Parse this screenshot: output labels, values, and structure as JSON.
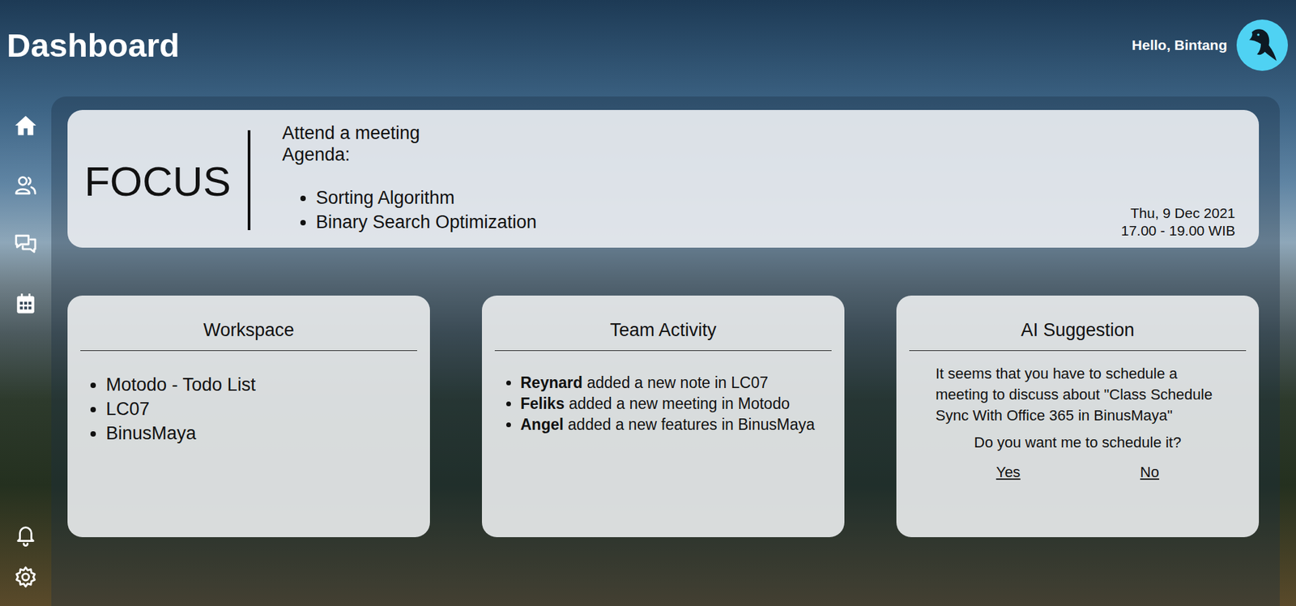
{
  "header": {
    "title": "Dashboard",
    "greeting": "Hello, Bintang"
  },
  "focus": {
    "label": "FOCUS",
    "title": "Attend a meeting",
    "agenda_label": "Agenda:",
    "agenda": [
      "Sorting Algorithm",
      "Binary Search Optimization"
    ],
    "date": "Thu, 9 Dec 2021",
    "time": "17.00 - 19.00 WIB"
  },
  "workspace": {
    "title": "Workspace",
    "items": [
      "Motodo - Todo List",
      "LC07",
      "BinusMaya"
    ]
  },
  "team_activity": {
    "title": "Team Activity",
    "items": [
      {
        "user": "Reynard",
        "action": "added a new note in LC07"
      },
      {
        "user": "Feliks",
        "action": "added a new meeting in Motodo"
      },
      {
        "user": "Angel",
        "action": "added a new features in BinusMaya"
      }
    ]
  },
  "ai_suggestion": {
    "title": "AI Suggestion",
    "message": "It seems that you have to schedule a meeting to discuss about \"Class Schedule Sync With Office 365 in BinusMaya\"",
    "question": "Do you want me to schedule it?",
    "buttons": [
      "Yes",
      "No"
    ]
  }
}
